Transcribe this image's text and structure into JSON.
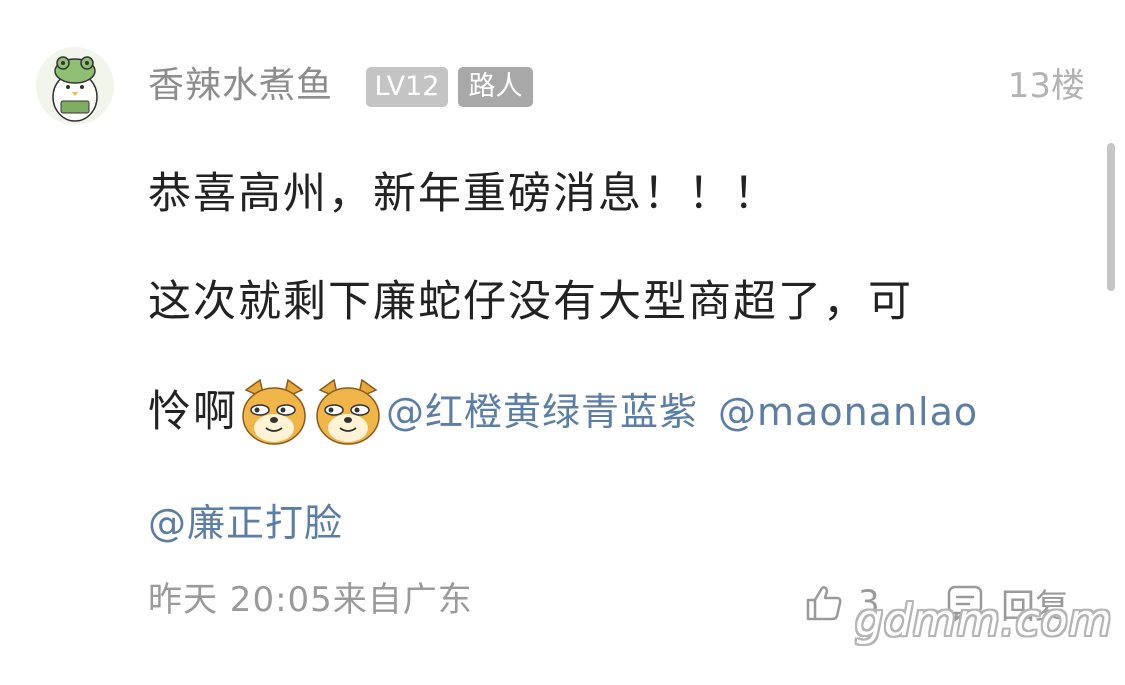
{
  "post": {
    "username": "香辣水煮鱼",
    "level_badge": "LV12",
    "role_badge": "路人",
    "floor": "13楼",
    "avatar_icon": "cartoon-chick-frog-hat-avatar"
  },
  "content": {
    "line1": "恭喜高州，新年重磅消息！！！",
    "line2": "这次就剩下廉蛇仔没有大型商超了，可",
    "line3_text": "怜啊",
    "emojis": [
      "doge-emoji",
      "doge-emoji"
    ],
    "mentions": [
      "@红橙黄绿青蓝紫",
      "@maonanlao",
      "@廉正打脸"
    ]
  },
  "footer": {
    "time_location": "昨天 20:05来自广东",
    "like_count": "3",
    "reply_label": "回复"
  },
  "watermark": "gdmm.com",
  "colors": {
    "mention": "#5d7ea4",
    "meta_gray": "#9a9a9a",
    "badge_level": "#c4c4c4",
    "badge_role": "#a8a8a8"
  }
}
